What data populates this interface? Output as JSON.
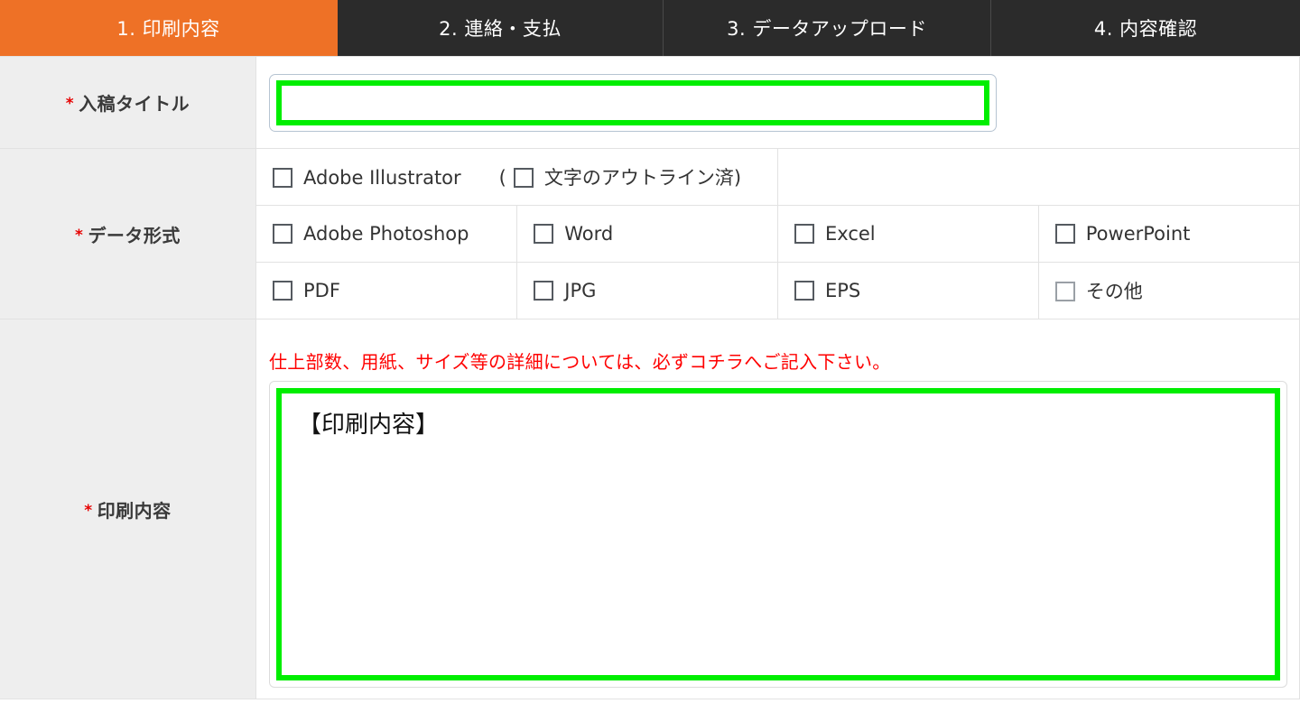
{
  "tabs": [
    {
      "label": "1. 印刷内容",
      "active": true
    },
    {
      "label": "2. 連絡・支払",
      "active": false
    },
    {
      "label": "3. データアップロード",
      "active": false
    },
    {
      "label": "4. 内容確認",
      "active": false
    }
  ],
  "colors": {
    "active_tab_bg": "#ee7126",
    "tab_bg": "#2b2b2b",
    "required_mark": "#e60000",
    "notice_text": "#ff0000",
    "focus_ring": "#00ee00",
    "label_bg": "#eeeeee"
  },
  "required_mark": "*",
  "rows": {
    "title": {
      "label": "入稿タイトル",
      "input_value": "",
      "input_placeholder": ""
    },
    "data_format": {
      "label": "データ形式",
      "grid": [
        [
          {
            "label": "Adobe Illustrator",
            "checked": false,
            "colspan": 2
          },
          {
            "label": "文字のアウトライン済",
            "checked": false,
            "colspan": 2,
            "paren": true
          }
        ],
        [
          {
            "label": "Adobe Photoshop",
            "checked": false
          },
          {
            "label": "Word",
            "checked": false
          },
          {
            "label": "Excel",
            "checked": false
          },
          {
            "label": "PowerPoint",
            "checked": false
          }
        ],
        [
          {
            "label": "PDF",
            "checked": false
          },
          {
            "label": "JPG",
            "checked": false
          },
          {
            "label": "EPS",
            "checked": false
          },
          {
            "label": "その他",
            "checked": false,
            "soft": true
          }
        ]
      ]
    },
    "print_content": {
      "label": "印刷内容",
      "notice": "仕上部数、用紙、サイズ等の詳細については、必ずコチラへご記入下さい。",
      "textarea_value": "【印刷内容】",
      "textarea_placeholder": ""
    }
  }
}
